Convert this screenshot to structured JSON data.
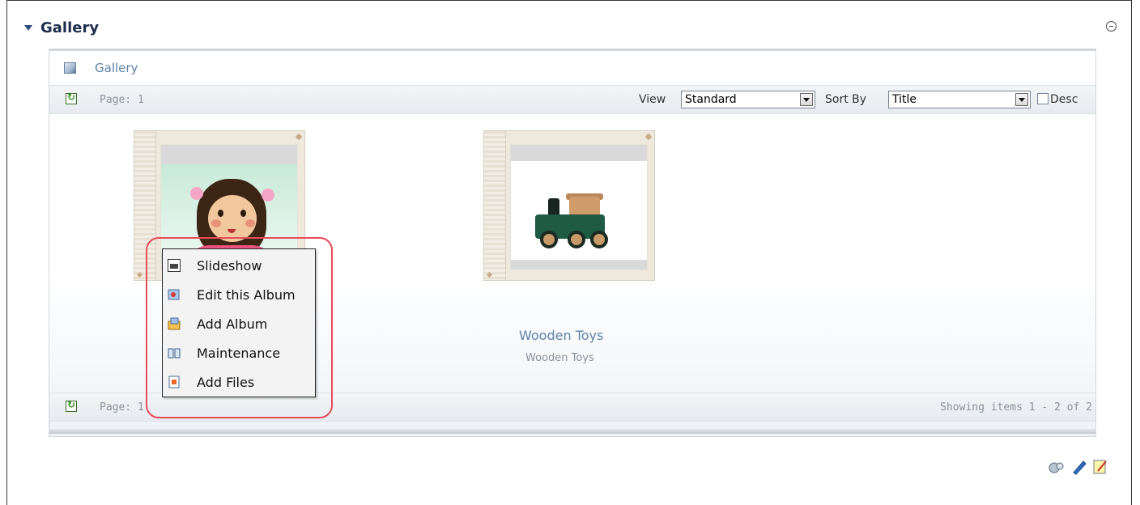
{
  "module": {
    "title": "Gallery"
  },
  "breadcrumb": {
    "label": "Gallery"
  },
  "top_pager": {
    "page_text": "Page: 1",
    "view_label": "View",
    "view_value": "Standard",
    "sort_label": "Sort By",
    "sort_value": "Title",
    "desc_label": "Desc"
  },
  "albums": [
    {
      "title": "",
      "description": ""
    },
    {
      "title": "Wooden Toys",
      "description": "Wooden Toys"
    }
  ],
  "context_menu": {
    "items": [
      {
        "label": "Slideshow",
        "icon": "slideshow-icon"
      },
      {
        "label": "Edit this Album",
        "icon": "edit-album-icon"
      },
      {
        "label": "Add Album",
        "icon": "add-album-icon"
      },
      {
        "label": "Maintenance",
        "icon": "maintenance-icon"
      },
      {
        "label": "Add Files",
        "icon": "add-files-icon"
      }
    ]
  },
  "bottom_pager": {
    "page_text": "Page: 1",
    "showing_text": "Showing items 1 - 2 of 2"
  },
  "footer_actions": [
    {
      "icon": "settings-icon"
    },
    {
      "icon": "edit-icon"
    },
    {
      "icon": "notes-icon"
    }
  ],
  "colors": {
    "link": "#5d82a8",
    "highlight": "#e84b59"
  }
}
